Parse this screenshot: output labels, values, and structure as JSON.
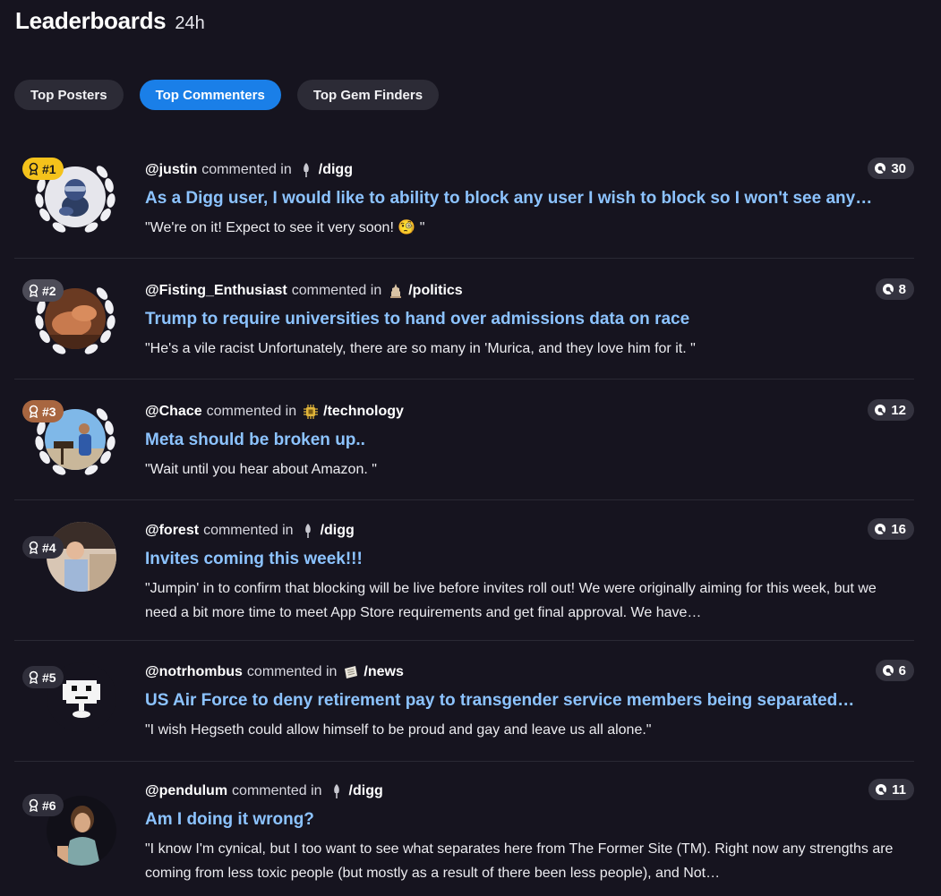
{
  "header": {
    "title": "Leaderboards",
    "period": "24h"
  },
  "tabs": [
    {
      "label": "Top Posters",
      "active": false
    },
    {
      "label": "Top Commenters",
      "active": true
    },
    {
      "label": "Top Gem Finders",
      "active": false
    }
  ],
  "colors": {
    "accent": "#1a7fe8",
    "title_link": "#8cc3ff",
    "gold": "#f4c21b",
    "bronze": "#a86640"
  },
  "entries": [
    {
      "rank": "#1",
      "user": "@justin",
      "verb": "commented in",
      "community": "/digg",
      "community_icon": "digg-shovel-icon",
      "title": "As a Digg user, I would like to ability to block any user I wish to block so I won't see any…",
      "quote": "\"We're on it! Expect to see it very soon! 🧐 \"",
      "comments": "30"
    },
    {
      "rank": "#2",
      "user": "@Fisting_Enthusiast",
      "verb": "commented in",
      "community": "/politics",
      "community_icon": "politics-icon",
      "title": "Trump to require universities to hand over admissions data on race",
      "quote": "\"He's a vile racist Unfortunately, there are so many in 'Murica, and they love him for it. \"",
      "comments": "8"
    },
    {
      "rank": "#3",
      "user": "@Chace",
      "verb": "commented in",
      "community": "/technology",
      "community_icon": "chip-icon",
      "title": "Meta should be broken up..",
      "quote": "\"Wait until you hear about Amazon. \"",
      "comments": "12"
    },
    {
      "rank": "#4",
      "user": "@forest",
      "verb": "commented in",
      "community": "/digg",
      "community_icon": "digg-shovel-icon",
      "title": "Invites coming this week!!!",
      "quote": "\"Jumpin' in to confirm that blocking will be live before invites roll out! We were originally aiming for this week, but we need a bit more time to meet App Store requirements and get final approval. We have…",
      "comments": "16"
    },
    {
      "rank": "#5",
      "user": "@notrhombus",
      "verb": "commented in",
      "community": "/news",
      "community_icon": "newspaper-icon",
      "title": "US Air Force to deny retirement pay to transgender service members being separated…",
      "quote": "\"I wish Hegseth could allow himself to be proud and gay and leave us all alone.\"",
      "comments": "6"
    },
    {
      "rank": "#6",
      "user": "@pendulum",
      "verb": "commented in",
      "community": "/digg",
      "community_icon": "digg-shovel-icon",
      "title": "Am I doing it wrong?",
      "quote": "\"I know I'm cynical, but I too want to see what separates here from The Former Site (TM). Right now any strengths are coming from less toxic people (but mostly as a result of there been less people), and Not…",
      "comments": "11"
    }
  ]
}
